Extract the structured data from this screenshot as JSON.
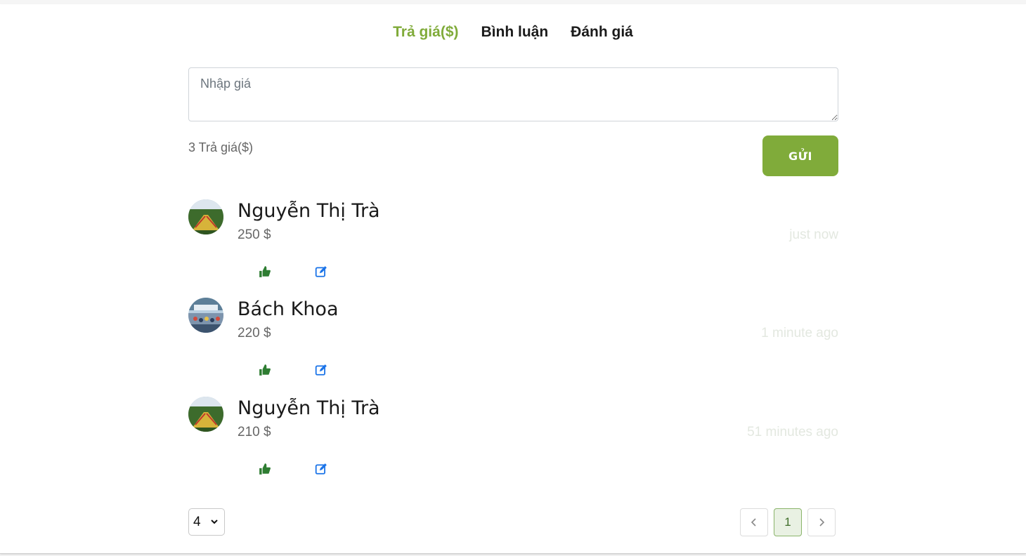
{
  "tabs": [
    {
      "label": "Trả giá($)",
      "active": true
    },
    {
      "label": "Bình luận",
      "active": false
    },
    {
      "label": "Đánh giá",
      "active": false
    }
  ],
  "bid_form": {
    "placeholder": "Nhập giá",
    "value": "",
    "count_label": "3 Trả giá($)",
    "send_label": "GỬI"
  },
  "bids": [
    {
      "name": "Nguyễn Thị Trà",
      "amount": "250 $",
      "time": "just now",
      "avatar": "stadium-photo"
    },
    {
      "name": "Bách Khoa",
      "amount": "220 $",
      "time": "1 minute ago",
      "avatar": "crowd-photo"
    },
    {
      "name": "Nguyễn Thị Trà",
      "amount": "210 $",
      "time": "51 minutes ago",
      "avatar": "stadium-photo"
    }
  ],
  "pagination": {
    "page_size": "4",
    "prev_icon": "chevron-left-icon",
    "next_icon": "chevron-right-icon",
    "current_page": "1"
  },
  "colors": {
    "accent": "#80ab3a",
    "like": "#2e7d32",
    "edit": "#1a73e8",
    "time": "#e3e8e0"
  }
}
